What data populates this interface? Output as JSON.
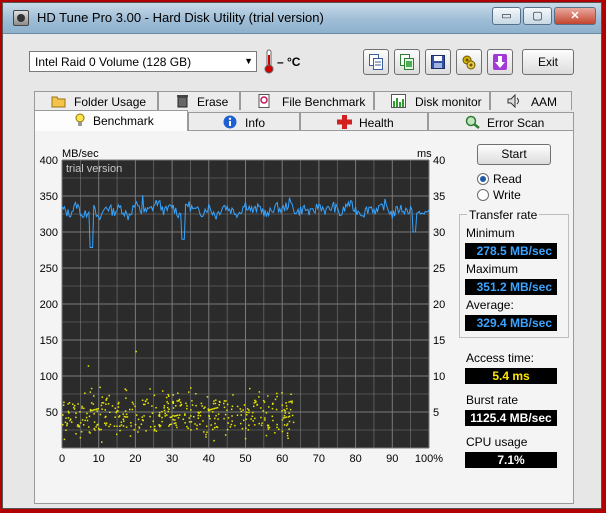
{
  "window": {
    "title": "HD Tune Pro 3.00 - Hard Disk Utility (trial version)"
  },
  "window_controls": {
    "minimize": "▭",
    "maximize": "▢",
    "close": "✕"
  },
  "toolbar": {
    "drive_select": "Intel   Raid 0 Volume (128 GB)",
    "temperature": "– °C",
    "buttons": [
      "copy-text-icon",
      "copy-screenshot-icon",
      "save-icon",
      "options-icon",
      "down-arrow-icon"
    ],
    "exit_label": "Exit"
  },
  "tabs_top": [
    "Folder Usage",
    "Erase",
    "File Benchmark",
    "Disk monitor",
    "AAM"
  ],
  "tabs_bottom": [
    "Benchmark",
    "Info",
    "Health",
    "Error Scan"
  ],
  "active_tab": "Benchmark",
  "controls": {
    "start_label": "Start",
    "read_label": "Read",
    "write_label": "Write",
    "selected_mode": "Read"
  },
  "results": {
    "transfer_rate_title": "Transfer rate",
    "minimum_label": "Minimum",
    "minimum_value": "278.5 MB/sec",
    "maximum_label": "Maximum",
    "maximum_value": "351.2 MB/sec",
    "average_label": "Average:",
    "average_value": "329.4 MB/sec",
    "access_time_label": "Access time:",
    "access_time_value": "5.4 ms",
    "burst_rate_label": "Burst rate",
    "burst_rate_value": "1125.4 MB/sec",
    "cpu_usage_label": "CPU usage",
    "cpu_usage_value": "7.1%"
  },
  "colors": {
    "transfer_line": "#36a4ff",
    "access_dots": "#e8e800",
    "plot_background": "#2b2b2b",
    "grid": "#7a7a7a"
  },
  "chart_data": {
    "type": "line",
    "watermark": "trial version",
    "y_left_label": "MB/sec",
    "y_right_label": "ms",
    "y_left_ticks": [
      "400",
      "350",
      "300",
      "250",
      "200",
      "150",
      "100",
      "50"
    ],
    "y_right_ticks": [
      "40",
      "35",
      "30",
      "25",
      "20",
      "15",
      "10",
      "5"
    ],
    "x_ticks": [
      "0",
      "10",
      "20",
      "30",
      "40",
      "50",
      "60",
      "70",
      "80",
      "90",
      "100%"
    ],
    "ylim_left": [
      0,
      400
    ],
    "ylim_right": [
      0,
      40
    ],
    "xlim": [
      0,
      100
    ],
    "series": [
      {
        "name": "Transfer rate",
        "axis": "left",
        "x": [
          0,
          2,
          4,
          6,
          8,
          10,
          12,
          14,
          16,
          18,
          20,
          22,
          24,
          26,
          28,
          30,
          32,
          34,
          36,
          38,
          40,
          42,
          44,
          46,
          48,
          50,
          52,
          54,
          56,
          58,
          60,
          62,
          64,
          66,
          68,
          70,
          72,
          74,
          76,
          78,
          80,
          82,
          84,
          86,
          88,
          90,
          92,
          94,
          96,
          98,
          100
        ],
        "y": [
          332,
          325,
          338,
          320,
          340,
          315,
          336,
          328,
          334,
          322,
          338,
          326,
          331,
          342,
          328,
          336,
          324,
          340,
          330,
          327,
          335,
          323,
          337,
          331,
          326,
          339,
          329,
          334,
          322,
          336,
          330,
          341,
          327,
          333,
          325,
          338,
          329,
          336,
          324,
          340,
          331,
          326,
          335,
          328,
          339,
          324,
          333,
          329,
          337,
          322,
          331
        ],
        "dips": [
          {
            "x": 8,
            "y": 278.5
          },
          {
            "x": 33,
            "y": 290
          },
          {
            "x": 96,
            "y": 300
          }
        ],
        "max_point": {
          "x": 22,
          "y": 351.2
        }
      },
      {
        "name": "Access time",
        "axis": "right",
        "type": "scatter",
        "x_range": [
          0,
          63
        ],
        "y_range_ms": [
          0.5,
          9.5
        ],
        "typical_ms": 5.4,
        "count": 420
      }
    ]
  }
}
